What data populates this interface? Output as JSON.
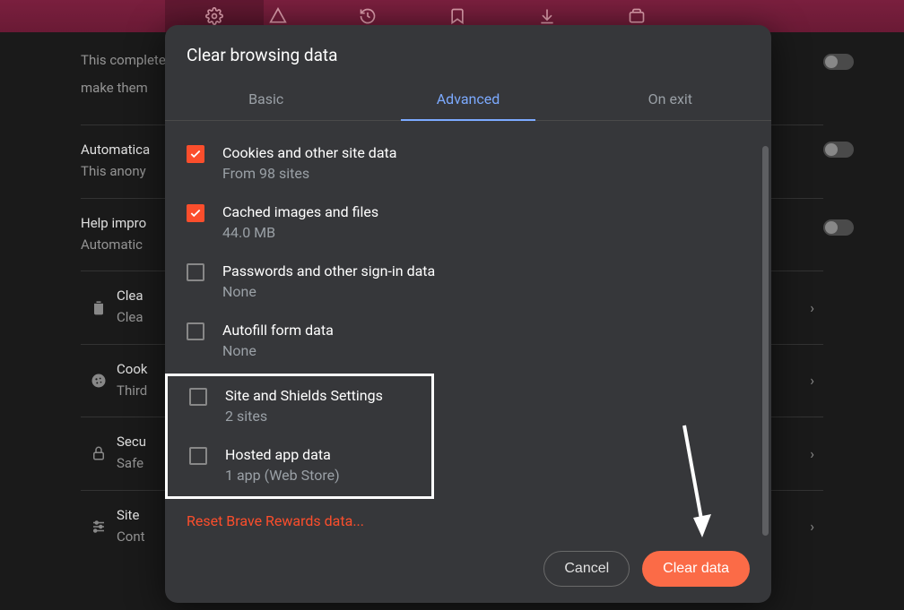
{
  "bg": {
    "line1": "This completely",
    "line2": "make them",
    "items": [
      {
        "title": "Automatica",
        "desc": "This anony"
      },
      {
        "title": "Help impro",
        "desc": "Automatic"
      }
    ],
    "rows": [
      {
        "title": "Clea",
        "desc": "Clea"
      },
      {
        "title": "Cook",
        "desc": "Third"
      },
      {
        "title": "Secu",
        "desc": "Safe"
      },
      {
        "title": "Site ",
        "desc": "Cont"
      }
    ]
  },
  "dialog": {
    "title": "Clear browsing data",
    "tabs": {
      "basic": "Basic",
      "advanced": "Advanced",
      "onexit": "On exit"
    },
    "options": [
      {
        "title": "Cookies and other site data",
        "desc": "From 98 sites",
        "checked": true
      },
      {
        "title": "Cached images and files",
        "desc": "44.0 MB",
        "checked": true
      },
      {
        "title": "Passwords and other sign-in data",
        "desc": "None",
        "checked": false
      },
      {
        "title": "Autofill form data",
        "desc": "None",
        "checked": false
      },
      {
        "title": "Site and Shields Settings",
        "desc": "2 sites",
        "checked": false
      },
      {
        "title": "Hosted app data",
        "desc": "1 app (Web Store)",
        "checked": false
      }
    ],
    "reset": "Reset Brave Rewards data...",
    "cancel": "Cancel",
    "clear": "Clear data"
  }
}
